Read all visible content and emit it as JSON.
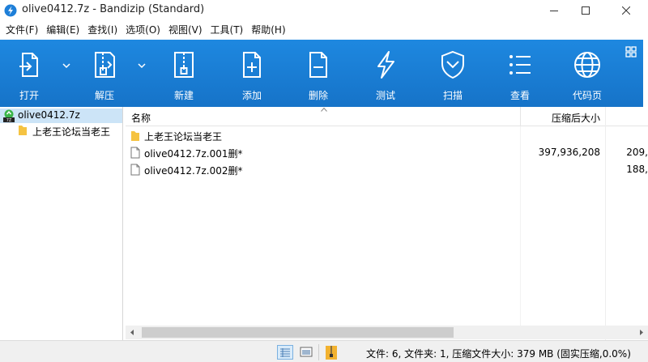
{
  "window": {
    "title": "olive0412.7z - Bandizip (Standard)"
  },
  "menu": [
    {
      "label": "文件(F)"
    },
    {
      "label": "编辑(E)"
    },
    {
      "label": "查找(I)"
    },
    {
      "label": "选项(O)"
    },
    {
      "label": "视图(V)"
    },
    {
      "label": "工具(T)"
    },
    {
      "label": "帮助(H)"
    }
  ],
  "toolbar": {
    "open": "打开",
    "extract": "解压",
    "new": "新建",
    "add": "添加",
    "delete": "删除",
    "test": "测试",
    "scan": "扫描",
    "view": "查看",
    "codepage": "代码页"
  },
  "tree": {
    "root": "olive0412.7z",
    "child": "上老王论坛当老王"
  },
  "list": {
    "columns": {
      "name": "名称",
      "packed_size": "压缩后大小"
    },
    "rows": [
      {
        "name": "上老王论坛当老王",
        "type": "folder",
        "packed_size": "",
        "orig": ""
      },
      {
        "name": "olive0412.7z.001删*",
        "type": "file",
        "packed_size": "397,936,208",
        "orig": "209,"
      },
      {
        "name": "olive0412.7z.002删*",
        "type": "file",
        "packed_size": "",
        "orig": "188,"
      }
    ]
  },
  "status": {
    "text": "文件: 6, 文件夹: 1, 压缩文件大小: 379 MB (固实压缩,0.0%)"
  },
  "colors": {
    "toolbar": "#1a7fd6",
    "selection": "#cce4f7",
    "folder": "#f5c342"
  }
}
